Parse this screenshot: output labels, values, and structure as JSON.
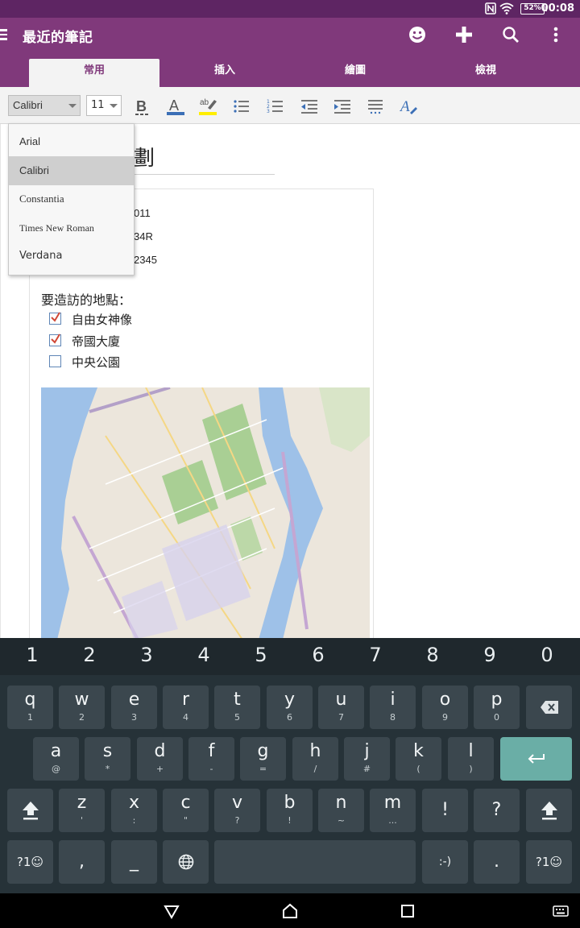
{
  "status_bar": {
    "battery_label": "52%",
    "time": "00:08"
  },
  "app_bar": {
    "title": "最近的筆記",
    "icons": [
      "menu-icon",
      "smiley-icon",
      "plus-icon",
      "search-icon",
      "more-vert-icon"
    ]
  },
  "ribbon": {
    "tabs": [
      {
        "label": "常用",
        "active": true
      },
      {
        "label": "插入",
        "active": false
      },
      {
        "label": "繪圖",
        "active": false
      },
      {
        "label": "檢視",
        "active": false
      }
    ]
  },
  "toolbar": {
    "font_value": "Calibri",
    "size_value": "11",
    "colors": {
      "font_color": "#3b6fb6",
      "highlight": "#ffee00"
    },
    "tools": [
      "bold-icon",
      "font-color-icon",
      "highlight-icon",
      "bullet-list-icon",
      "numbered-list-icon",
      "outdent-icon",
      "indent-icon",
      "line-spacing-icon",
      "styles-icon"
    ]
  },
  "font_dropdown": {
    "options": [
      {
        "label": "Arial",
        "selected": false
      },
      {
        "label": "Calibri",
        "selected": true
      },
      {
        "label": "Constantia",
        "selected": false
      },
      {
        "label": "Times New Roman",
        "selected": false
      },
      {
        "label": "Verdana",
        "selected": false
      }
    ]
  },
  "note": {
    "title_fragment": "劃",
    "info_lines": [
      "011",
      "34R",
      "2345"
    ],
    "places_label": "要造訪的地點：",
    "todos": [
      {
        "text": "自由女神像",
        "checked": true
      },
      {
        "text": "帝國大廈",
        "checked": true
      },
      {
        "text": "中央公園",
        "checked": false
      }
    ]
  },
  "keyboard": {
    "number_row": [
      "1",
      "2",
      "3",
      "4",
      "5",
      "6",
      "7",
      "8",
      "9",
      "0"
    ],
    "row1": [
      {
        "main": "q",
        "sub": "1"
      },
      {
        "main": "w",
        "sub": "2"
      },
      {
        "main": "e",
        "sub": "3"
      },
      {
        "main": "r",
        "sub": "4"
      },
      {
        "main": "t",
        "sub": "5"
      },
      {
        "main": "y",
        "sub": "6"
      },
      {
        "main": "u",
        "sub": "7"
      },
      {
        "main": "i",
        "sub": "8"
      },
      {
        "main": "o",
        "sub": "9"
      },
      {
        "main": "p",
        "sub": "0"
      }
    ],
    "row2": [
      {
        "main": "a",
        "sub": "@"
      },
      {
        "main": "s",
        "sub": "*"
      },
      {
        "main": "d",
        "sub": "+"
      },
      {
        "main": "f",
        "sub": "-"
      },
      {
        "main": "g",
        "sub": "="
      },
      {
        "main": "h",
        "sub": "/"
      },
      {
        "main": "j",
        "sub": "#"
      },
      {
        "main": "k",
        "sub": "("
      },
      {
        "main": "l",
        "sub": ")"
      }
    ],
    "row3": [
      {
        "main": "z",
        "sub": "'"
      },
      {
        "main": "x",
        "sub": ":"
      },
      {
        "main": "c",
        "sub": "\""
      },
      {
        "main": "v",
        "sub": "?"
      },
      {
        "main": "b",
        "sub": "!"
      },
      {
        "main": "n",
        "sub": "~"
      },
      {
        "main": "m",
        "sub": "..."
      }
    ],
    "row3_punct": [
      "!",
      "?"
    ],
    "row4": {
      "symbols_left": "?1☺",
      "comma": ",",
      "underscore": "_",
      "emoticon": ":-)",
      "period": ".",
      "symbols_right": "?1☺"
    },
    "enter_color": "#6aaea6"
  }
}
